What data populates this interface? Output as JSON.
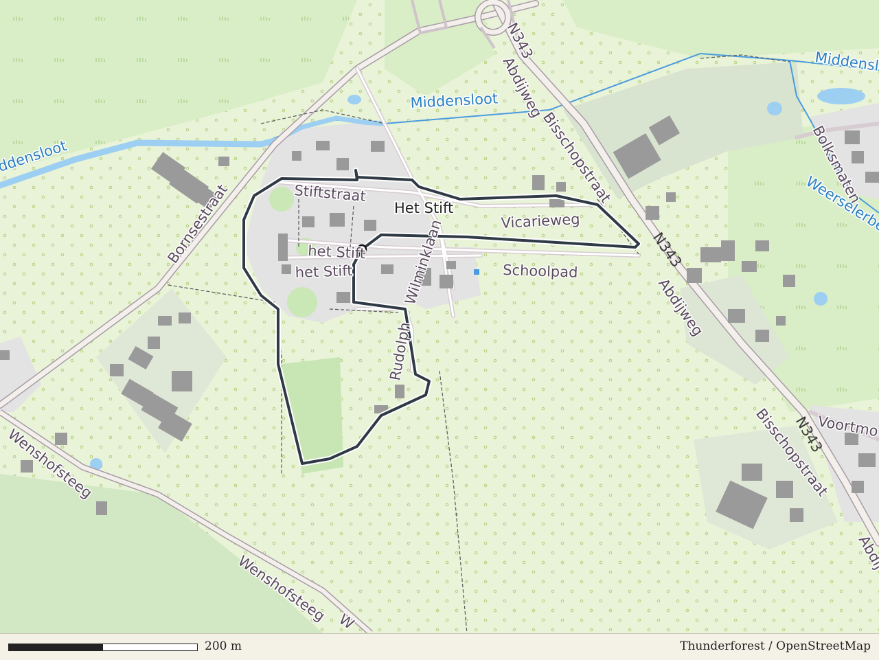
{
  "map": {
    "labels": {
      "middensloot_right": "Middenslo",
      "middensloot_center": "Middensloot",
      "middensloot_left": "ddensloot",
      "n343_top": "N343",
      "abdijweg_top": "Abdijweg",
      "bisschopstraat_top": "Bisschopstraat",
      "stiftstraat": "Stiftstraat",
      "het_stift_place": "Het Stift",
      "vicarieweg": "Vicarieweg",
      "het_stift_1": "het Stift",
      "het_stift_2": "het Stift",
      "schoolpad": "Schoolpad",
      "wilminklaan": "Wilminklaan",
      "rudolph": "Rudolph",
      "bornsestraat": "Bornsestraat",
      "n343_mid": "N343",
      "abdijweg_mid": "Abdijweg",
      "bolksmaten": "Bolksmaten",
      "weerselerbeek": "Weerselerbe",
      "n343_low": "N343",
      "bisschopstraat_low": "Bisschopstraat",
      "voortmors": "Voortmo",
      "abdijweg_low": "Abdij",
      "wenshofsteeg_1": "Wenshofsteeg",
      "wenshofsteeg_2": "Wenshofsteeg",
      "wenshofsteeg_3": "W"
    },
    "colors": {
      "background": "#e8f3d8",
      "forest": "#d5ecc0",
      "residential": "#dddddd",
      "water": "#4a9be0",
      "route": "#2f3a45",
      "building": "#9a9a9a"
    }
  },
  "footer": {
    "scale_label": "200 m",
    "attribution": "Thunderforest / OpenStreetMap"
  }
}
